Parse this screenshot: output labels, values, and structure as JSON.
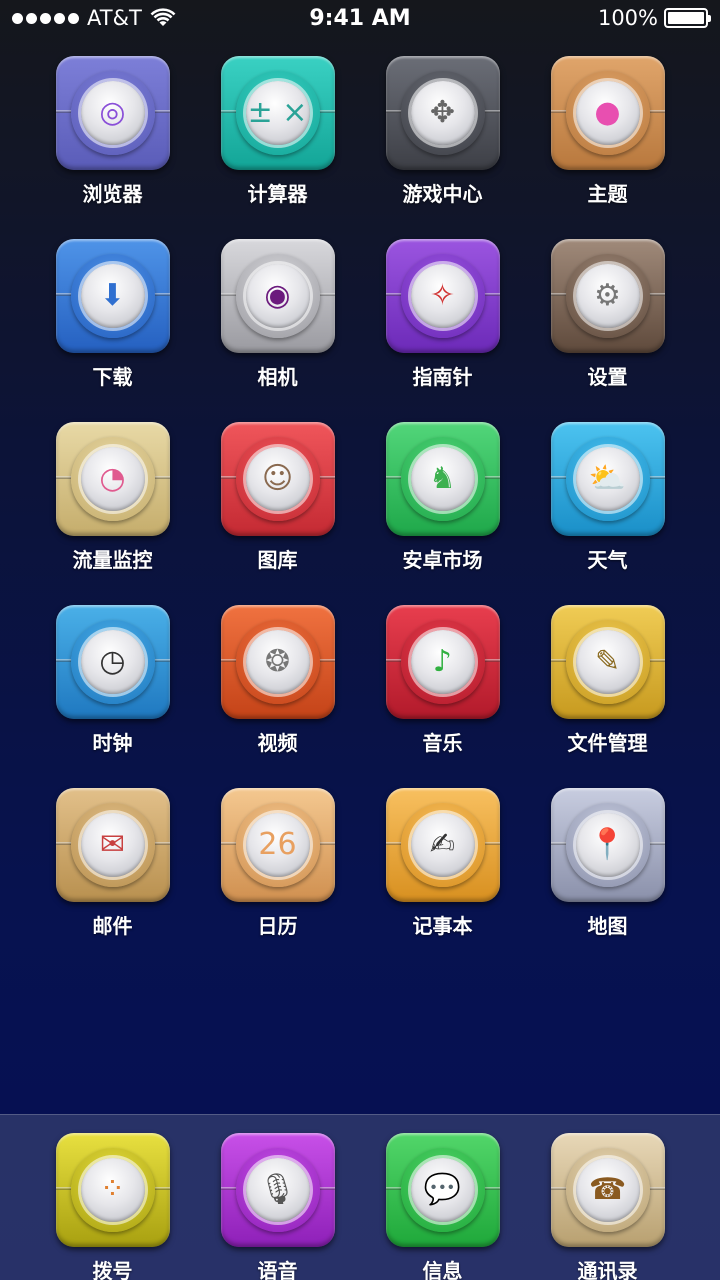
{
  "status": {
    "carrier": "AT&T",
    "time": "9:41 AM",
    "battery": "100%",
    "battery_level": 1.0
  },
  "apps": [
    {
      "label": "浏览器",
      "icon": "browser-icon",
      "bg": "#7d7fd8",
      "bg2": "#5a5cb8",
      "glyph": "◎",
      "glyph_color": "#8a4fd8"
    },
    {
      "label": "计算器",
      "icon": "calculator-icon",
      "bg": "#3ad1c3",
      "bg2": "#13a597",
      "glyph": "± ×",
      "glyph_color": "#2aa397"
    },
    {
      "label": "游戏中心",
      "icon": "gamepad-icon",
      "bg": "#6b6e77",
      "bg2": "#3d3f46",
      "glyph": "✥",
      "glyph_color": "#666"
    },
    {
      "label": "主题",
      "icon": "theme-icon",
      "bg": "#e0a56b",
      "bg2": "#b8783d",
      "glyph": "●",
      "glyph_color": "#e84fb0"
    },
    {
      "label": "下载",
      "icon": "download-icon",
      "bg": "#4f94e8",
      "bg2": "#2560c0",
      "glyph": "⬇",
      "glyph_color": "#2f6fd0"
    },
    {
      "label": "相机",
      "icon": "camera-icon",
      "bg": "#d8d8dc",
      "bg2": "#9a9aa0",
      "glyph": "◉",
      "glyph_color": "#6b1a7d"
    },
    {
      "label": "指南针",
      "icon": "compass-icon",
      "bg": "#9b55e0",
      "bg2": "#6c2ab8",
      "glyph": "✧",
      "glyph_color": "#d03030"
    },
    {
      "label": "设置",
      "icon": "gear-icon",
      "bg": "#a08a7a",
      "bg2": "#5f4a3c",
      "glyph": "⚙",
      "glyph_color": "#777"
    },
    {
      "label": "流量监控",
      "icon": "data-usage-icon",
      "bg": "#e8d9a6",
      "bg2": "#c5ad6c",
      "glyph": "◔",
      "glyph_color": "#e05a8f"
    },
    {
      "label": "图库",
      "icon": "gallery-icon",
      "bg": "#f0565b",
      "bg2": "#c42a33",
      "glyph": "☺",
      "glyph_color": "#8a6a50"
    },
    {
      "label": "安卓市场",
      "icon": "android-market-icon",
      "bg": "#52d67a",
      "bg2": "#1fa84a",
      "glyph": "♞",
      "glyph_color": "#3cb04f"
    },
    {
      "label": "天气",
      "icon": "weather-icon",
      "bg": "#4cc3f0",
      "bg2": "#1a8fc8",
      "glyph": "⛅",
      "glyph_color": "#f0a020"
    },
    {
      "label": "时钟",
      "icon": "clock-icon",
      "bg": "#4ab0e8",
      "bg2": "#1f78c0",
      "glyph": "◷",
      "glyph_color": "#333"
    },
    {
      "label": "视频",
      "icon": "film-reel-icon",
      "bg": "#f07240",
      "bg2": "#c44318",
      "glyph": "❂",
      "glyph_color": "#777"
    },
    {
      "label": "音乐",
      "icon": "music-icon",
      "bg": "#e83e4e",
      "bg2": "#b21a2b",
      "glyph": "♪",
      "glyph_color": "#30b040"
    },
    {
      "label": "文件管理",
      "icon": "file-manager-icon",
      "bg": "#f0cc55",
      "bg2": "#c79a1f",
      "glyph": "✎",
      "glyph_color": "#8a6a20"
    },
    {
      "label": "邮件",
      "icon": "mail-icon",
      "bg": "#e2c08a",
      "bg2": "#b8904f",
      "glyph": "✉",
      "glyph_color": "#c84040"
    },
    {
      "label": "日历",
      "icon": "calendar-icon",
      "bg": "#f4c890",
      "bg2": "#d09050",
      "glyph": "26",
      "glyph_color": "#e8a060"
    },
    {
      "label": "记事本",
      "icon": "notepad-icon",
      "bg": "#f8c060",
      "bg2": "#d89020",
      "glyph": "✍",
      "glyph_color": "#333"
    },
    {
      "label": "地图",
      "icon": "map-icon",
      "bg": "#c8cde0",
      "bg2": "#8a90aa",
      "glyph": "📍",
      "glyph_color": "#d02828"
    }
  ],
  "dock": [
    {
      "label": "拨号",
      "icon": "dialer-icon",
      "bg": "#e8e040",
      "bg2": "#a8a010",
      "glyph": "⁘",
      "glyph_color": "#e08030"
    },
    {
      "label": "语音",
      "icon": "microphone-icon",
      "bg": "#c850e8",
      "bg2": "#8e20b8",
      "glyph": "🎙",
      "glyph_color": "#555"
    },
    {
      "label": "信息",
      "icon": "messages-icon",
      "bg": "#52d66a",
      "bg2": "#1fa83a",
      "glyph": "💬",
      "glyph_color": "#888"
    },
    {
      "label": "通讯录",
      "icon": "contacts-icon",
      "bg": "#e8d8b8",
      "bg2": "#b8a070",
      "glyph": "☎",
      "glyph_color": "#8a5a20"
    }
  ]
}
